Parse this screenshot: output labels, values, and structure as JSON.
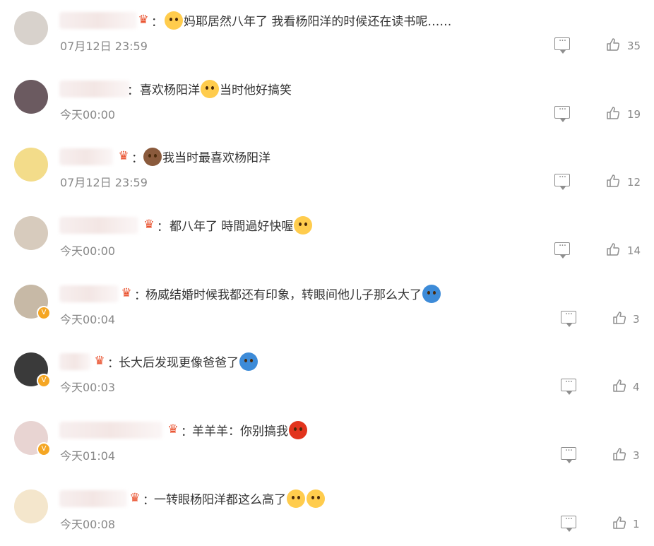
{
  "comments": [
    {
      "text": "妈耶居然八年了 我看杨阳洋的时候还在读书呢……",
      "time": "07月12日 23:59",
      "likes": "35",
      "emoji_before": "crying-laughing-emoji",
      "verified": false
    },
    {
      "text": "喜欢杨阳洋",
      "text2": "当时他好搞笑",
      "time": "今天00:00",
      "likes": "19",
      "emoji_mid": "laughing-emoji",
      "verified": false
    },
    {
      "text": "我当时最喜欢杨阳洋",
      "time": "07月12日 23:59",
      "likes": "12",
      "emoji_before": "monkey-emoji",
      "verified": false
    },
    {
      "text": "都八年了 時間過好快喔",
      "time": "今天00:00",
      "likes": "14",
      "emoji_after": "pleading-emoji",
      "verified": false
    },
    {
      "text": "杨威结婚时候我都还有印象，转眼间他儿子那么大了",
      "time": "今天00:04",
      "likes": "3",
      "emoji_after": "doraemon-emoji",
      "verified": true
    },
    {
      "text": "长大后发现更像爸爸了",
      "time": "今天00:03",
      "likes": "4",
      "emoji_after": "doraemon-emoji",
      "verified": true
    },
    {
      "text": "羊羊羊：你别搞我",
      "time": "今天01:04",
      "likes": "3",
      "emoji_after": "angry-emoji",
      "verified": true
    },
    {
      "text": "一转眼杨阳洋都这么高了",
      "time": "今天00:08",
      "likes": "1",
      "emoji_after": "shocked-emoji",
      "verified": false
    }
  ],
  "colon": "："
}
